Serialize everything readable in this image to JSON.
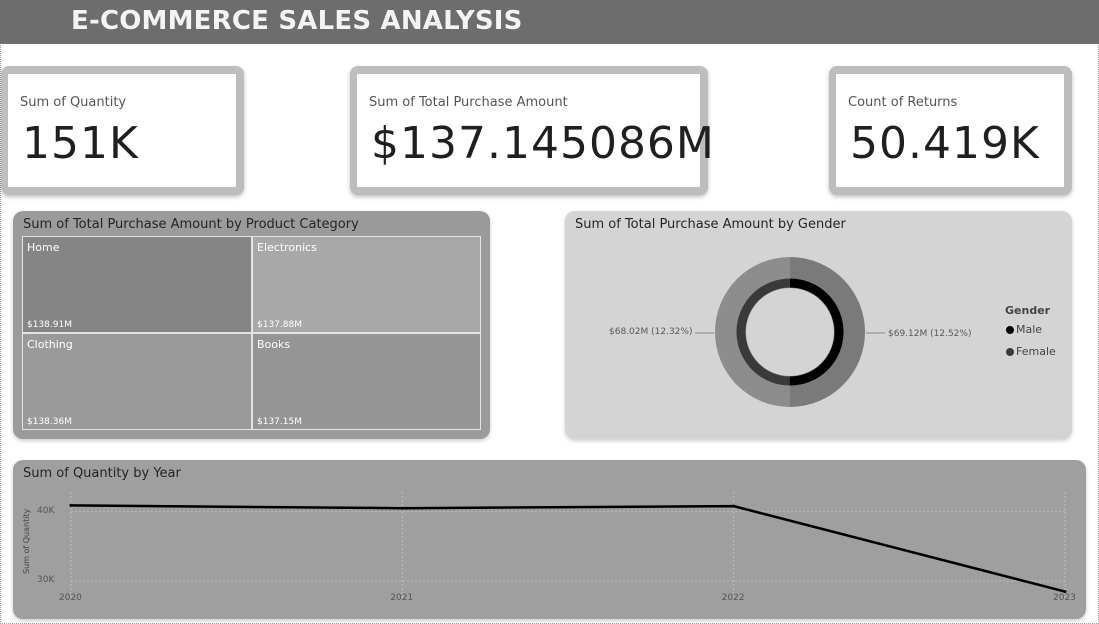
{
  "header": {
    "title": "E-COMMERCE SALES ANALYSIS"
  },
  "kpis": [
    {
      "label": "Sum of Quantity",
      "value": "151K"
    },
    {
      "label": "Sum of Total Purchase Amount",
      "value": "$137.145086M"
    },
    {
      "label": "Count of Returns",
      "value": "50.419K"
    }
  ],
  "chart_data": [
    {
      "type": "treemap",
      "title": "Sum of Total Purchase Amount by Product Category",
      "categories": [
        "Home",
        "Electronics",
        "Clothing",
        "Books"
      ],
      "values": [
        138.91,
        137.88,
        138.36,
        137.15
      ],
      "value_labels": [
        "$138.91M",
        "$137.88M",
        "$138.36M",
        "$137.15M"
      ],
      "colors": [
        "#858585",
        "#a8a8a8",
        "#9a9a9a",
        "#959595"
      ]
    },
    {
      "type": "donut",
      "title": "Sum of Total Purchase Amount by Gender",
      "legend_title": "Gender",
      "legend_position": "right",
      "categories": [
        "Male",
        "Female"
      ],
      "values": [
        69.12,
        68.02
      ],
      "data_labels": [
        "$69.12M (12.52%)",
        "$68.02M (12.32%)"
      ],
      "colors": [
        "#000000",
        "#3a3a3a"
      ]
    },
    {
      "type": "line",
      "title": "Sum of Quantity by Year",
      "x": [
        "2020",
        "2021",
        "2022",
        "2023"
      ],
      "series": [
        {
          "values": [
            40900,
            40500,
            40800,
            28500
          ],
          "color": "#000000"
        }
      ],
      "ylabel": "Sum of Quantity",
      "xlabel": "",
      "ylim": [
        27000,
        46000
      ],
      "yticks": [
        30000,
        40000
      ],
      "ytick_labels": [
        "30K",
        "40K"
      ],
      "grid": true
    }
  ]
}
